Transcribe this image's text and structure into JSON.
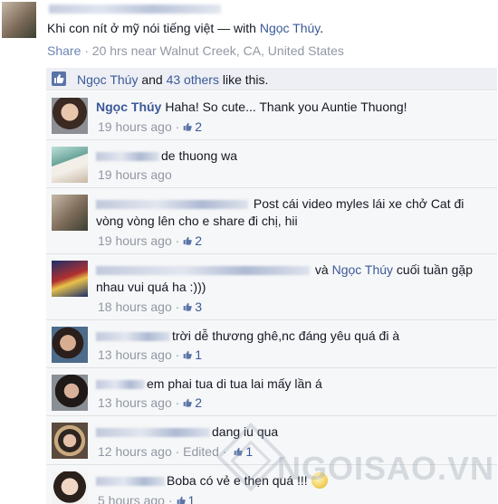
{
  "post": {
    "text": "Khi con nít ở mỹ nói tiếng việt",
    "with_prefix": " — with ",
    "tagged": "Ngọc Thúy",
    "tagged_suffix": ".",
    "share": "Share",
    "meta": " · 20 hrs near Walnut Creek, CA, United States"
  },
  "likes": {
    "name": "Ngọc Thúy",
    "and": " and ",
    "others": "43 others",
    "suffix": " like this."
  },
  "comments": [
    {
      "author": "Ngọc Thúy",
      "text": "Haha! So cute... Thank you Auntie Thuong!",
      "time": "19 hours ago",
      "likes": "2"
    },
    {
      "author": "",
      "text": "de thuong wa",
      "time": "19 hours ago",
      "likes": ""
    },
    {
      "author": "",
      "text": "Post cái video myles lái xe chở Cat đi vòng vòng lên cho e share đi chị, hii",
      "time": "19 hours ago",
      "likes": "2"
    },
    {
      "author": "",
      "and": " và ",
      "mention": "Ngọc Thúy",
      "text": " cuối tuần gặp nhau vui quá ha :)))",
      "time": "18 hours ago",
      "likes": "3"
    },
    {
      "author": "",
      "text": "trời dễ thương ghê,nc đáng yêu quá đi à",
      "time": "13 hours ago",
      "likes": "1"
    },
    {
      "author": "",
      "text": "em phai tua di tua lai mấy lần á",
      "time": "13 hours ago",
      "likes": "2"
    },
    {
      "author": "",
      "text": "dang iu qua",
      "time": "12 hours ago",
      "edited": " · Edited · ",
      "likes": "1"
    },
    {
      "author": "",
      "text": "Boba có vẻ e thẹn quá !!!",
      "time": "5 hours ago",
      "likes": "1"
    }
  ],
  "watermark": "NGOISAO.VN",
  "colors": {
    "link": "#3b5998",
    "meta": "#9197a3",
    "comment_bg": "#f6f7f8"
  },
  "icons": [
    "like-thumb-icon",
    "emoji-icon"
  ]
}
